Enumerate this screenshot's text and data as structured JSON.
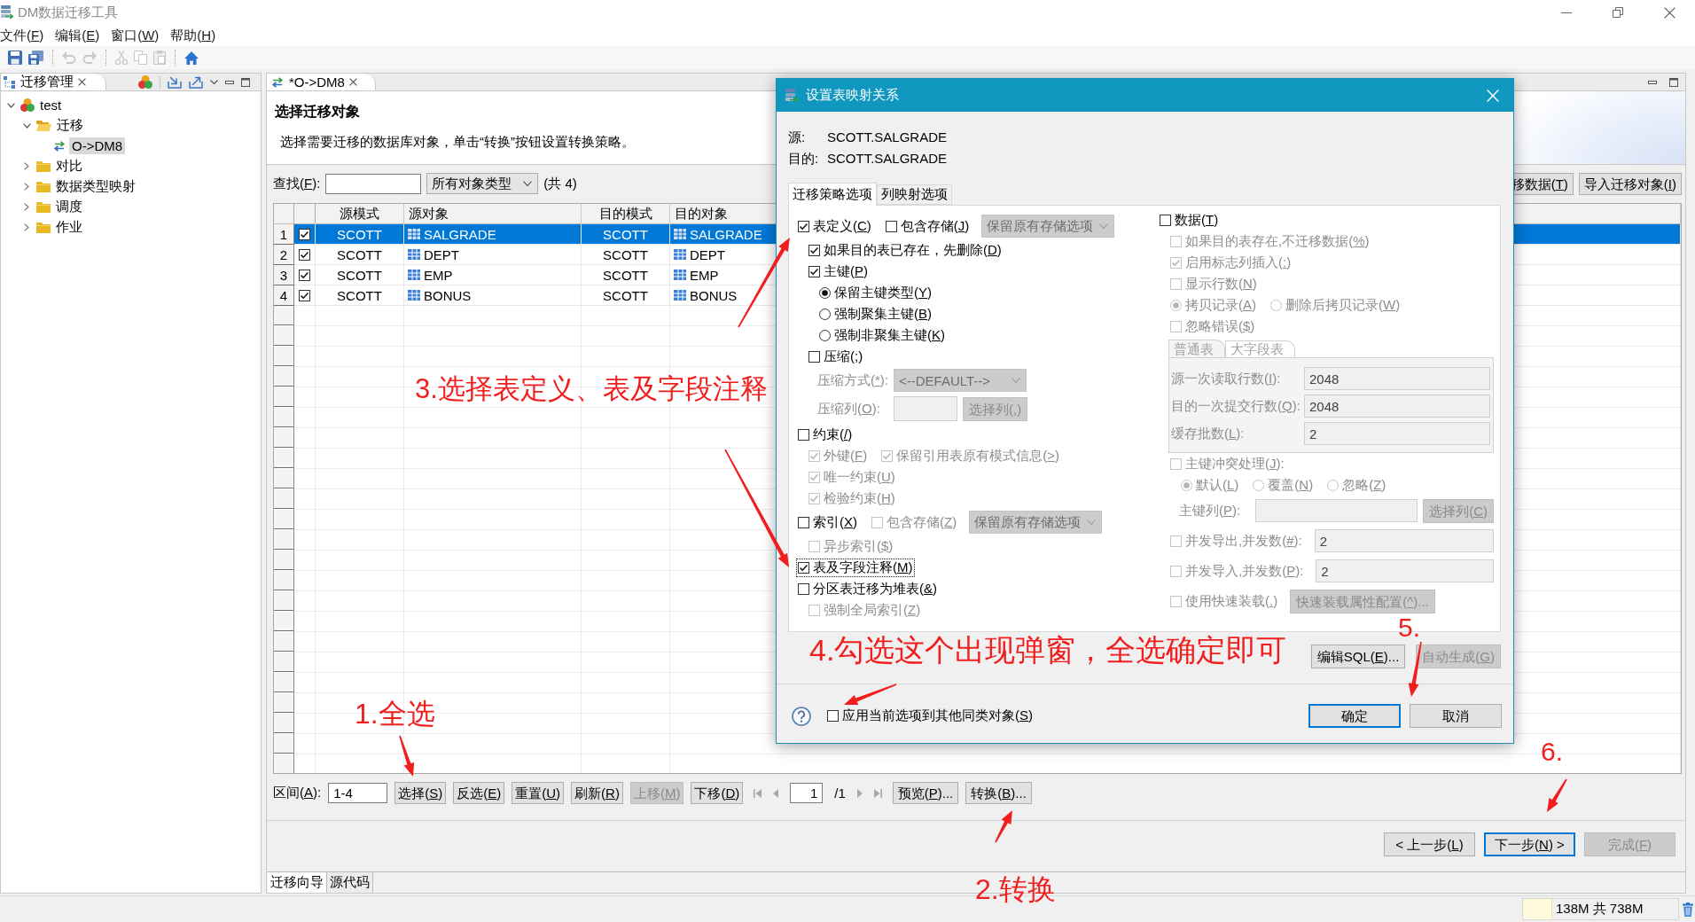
{
  "window": {
    "title": "DM数据迁移工具"
  },
  "menu": [
    "文件(F)",
    "编辑(E)",
    "窗口(W)",
    "帮助(H)"
  ],
  "toolbar": [
    {
      "kind": "save",
      "disabled": false
    },
    {
      "kind": "save_all",
      "disabled": false
    },
    {
      "kind": "undo",
      "disabled": true
    },
    {
      "kind": "redo",
      "disabled": true
    },
    {
      "kind": "cut",
      "disabled": true
    },
    {
      "kind": "copy",
      "disabled": true
    },
    {
      "kind": "paste",
      "disabled": true
    },
    {
      "kind": "home",
      "disabled": false
    }
  ],
  "navigator": {
    "tab": "迁移管理",
    "tree": [
      {
        "label": "test",
        "kind": "project",
        "expanded": true,
        "selected": false,
        "children": [
          {
            "label": "迁移",
            "kind": "folder",
            "expanded": true,
            "selected": false,
            "children": [
              {
                "label": "O->DM8",
                "kind": "migration",
                "selected": true
              }
            ]
          },
          {
            "label": "对比",
            "kind": "folder",
            "expanded": false,
            "selected": false
          },
          {
            "label": "数据类型映射",
            "kind": "folder",
            "expanded": false,
            "selected": false
          },
          {
            "label": "调度",
            "kind": "folder",
            "expanded": false,
            "selected": false
          },
          {
            "label": "作业",
            "kind": "folder",
            "expanded": false,
            "selected": false
          }
        ]
      }
    ]
  },
  "editor": {
    "tabs": [
      {
        "label": "*O->DM8",
        "selected": true
      }
    ],
    "title": "选择迁移对象",
    "description": "选择需要迁移的数据库对象，单击“转换”按钮设置转换策略。",
    "search_label": "查找(F):",
    "type_filter": "所有对象类型",
    "count": "(共 4)",
    "top_buttons": [
      "移数据(T)",
      "导入迁移对象(I)"
    ],
    "table": {
      "columns": [
        {
          "label": "源模式",
          "kind": "schema"
        },
        {
          "label": "源对象",
          "kind": "object"
        },
        {
          "label": "目的模式",
          "kind": "schema"
        },
        {
          "label": "目的对象",
          "kind": "object"
        }
      ],
      "rows": [
        {
          "number": "1",
          "checked": true,
          "selected": true,
          "cells": [
            "SCOTT",
            "SALGRADE",
            "SCOTT",
            "SALGRADE"
          ]
        },
        {
          "number": "2",
          "checked": true,
          "selected": false,
          "cells": [
            "SCOTT",
            "DEPT",
            "SCOTT",
            "DEPT"
          ]
        },
        {
          "number": "3",
          "checked": true,
          "selected": false,
          "cells": [
            "SCOTT",
            "EMP",
            "SCOTT",
            "EMP"
          ]
        },
        {
          "number": "4",
          "checked": true,
          "selected": false,
          "cells": [
            "SCOTT",
            "BONUS",
            "SCOTT",
            "BONUS"
          ]
        }
      ]
    },
    "range": {
      "label": "区间(A):",
      "value": "1-4"
    },
    "actions": [
      {
        "label": "选择(S)",
        "disabled": false
      },
      {
        "label": "反选(E)",
        "disabled": false
      },
      {
        "label": "重置(U)",
        "disabled": false
      },
      {
        "label": "刷新(R)",
        "disabled": false
      },
      {
        "label": "上移(M)",
        "disabled": true
      },
      {
        "label": "下移(D)",
        "disabled": false
      }
    ],
    "pager": {
      "page": "1",
      "total": "/1",
      "nav": [
        {
          "kind": "first",
          "disabled": true
        },
        {
          "kind": "previous",
          "disabled": true
        },
        {
          "kind": "next",
          "disabled": true
        },
        {
          "kind": "last",
          "disabled": true
        }
      ]
    },
    "more_actions": [
      {
        "label": "预览(P)...",
        "disabled": false
      },
      {
        "label": "转换(B)...",
        "disabled": false
      }
    ],
    "wizard_buttons": [
      {
        "label": "< 上一步(L)",
        "disabled": false,
        "default": false
      },
      {
        "label": "下一步(N) >",
        "disabled": false,
        "default": true
      },
      {
        "label": "完成(F)",
        "disabled": true,
        "default": false
      }
    ],
    "bottom_tabs": [
      {
        "label": "迁移向导",
        "selected": true
      },
      {
        "label": "源代码",
        "selected": false
      }
    ]
  },
  "status_bar": {
    "memory": {
      "reading": "138M 共 738M",
      "level": 0.19
    }
  },
  "dialog": {
    "title": "设置表映射关系",
    "source": {
      "label": "源:",
      "value": "SCOTT.SALGRADE"
    },
    "target": {
      "label": "目的:",
      "value": "SCOTT.SALGRADE"
    },
    "tabs": [
      {
        "label": "迁移策略选项",
        "selected": true
      },
      {
        "label": "列映射选项",
        "selected": false
      }
    ],
    "left_options": [
      {
        "kind": "options",
        "items": [
          {
            "kind": "checkbox",
            "label": "表定义(C)",
            "checked": true,
            "disabled": false,
            "focused": false
          },
          {
            "kind": "checkbox",
            "label": "包含存储(J)",
            "checked": false,
            "disabled": false,
            "focused": false
          },
          {
            "kind": "select",
            "value": "保留原有存储选项",
            "disabled": true
          }
        ],
        "children": [
          {
            "kind": "options",
            "items": [
              {
                "kind": "checkbox",
                "label": "如果目的表已存在，先删除(D)",
                "checked": true,
                "disabled": false,
                "focused": false
              }
            ]
          },
          {
            "kind": "options",
            "items": [
              {
                "kind": "checkbox",
                "label": "主键(P)",
                "checked": true,
                "disabled": false,
                "focused": false
              }
            ],
            "children": [
              {
                "kind": "options",
                "items": [
                  {
                    "kind": "radio",
                    "label": "保留主键类型(Y)",
                    "selected": true,
                    "disabled": false
                  }
                ]
              },
              {
                "kind": "options",
                "items": [
                  {
                    "kind": "radio",
                    "label": "强制聚集主键(B)",
                    "selected": false,
                    "disabled": false
                  }
                ]
              },
              {
                "kind": "options",
                "items": [
                  {
                    "kind": "radio",
                    "label": "强制非聚集主键(K)",
                    "selected": false,
                    "disabled": false
                  }
                ]
              }
            ]
          },
          {
            "kind": "options",
            "items": [
              {
                "kind": "checkbox",
                "label": "压缩(;)",
                "checked": false,
                "disabled": false,
                "focused": false
              }
            ],
            "children": [
              {
                "kind": "options",
                "items": [
                  {
                    "kind": "label",
                    "label": "压缩方式(*):",
                    "disabled": true
                  },
                  {
                    "kind": "select",
                    "value": "<--DEFAULT-->",
                    "disabled": true
                  }
                ]
              },
              {
                "kind": "options",
                "items": [
                  {
                    "kind": "label",
                    "label": "压缩列(O):",
                    "disabled": true
                  },
                  {
                    "kind": "input",
                    "disabled": true
                  },
                  {
                    "kind": "button",
                    "label": "选择列(,)",
                    "disabled": true
                  }
                ]
              }
            ]
          }
        ]
      },
      {
        "kind": "options",
        "items": [
          {
            "kind": "checkbox",
            "label": "约束(/)",
            "checked": false,
            "disabled": false,
            "focused": false
          }
        ],
        "children": [
          {
            "kind": "options",
            "items": [
              {
                "kind": "checkbox",
                "label": "外键(F)",
                "checked": true,
                "disabled": true,
                "focused": false
              },
              {
                "kind": "checkbox",
                "label": "保留引用表原有模式信息(>)",
                "checked": true,
                "disabled": true,
                "focused": false
              }
            ]
          },
          {
            "kind": "options",
            "items": [
              {
                "kind": "checkbox",
                "label": "唯一约束(U)",
                "checked": true,
                "disabled": true,
                "focused": false
              }
            ]
          },
          {
            "kind": "options",
            "items": [
              {
                "kind": "checkbox",
                "label": "检验约束(H)",
                "checked": true,
                "disabled": true,
                "focused": false
              }
            ]
          }
        ]
      },
      {
        "kind": "options",
        "items": [
          {
            "kind": "checkbox",
            "label": "索引(X)",
            "checked": false,
            "disabled": false,
            "focused": false
          },
          {
            "kind": "checkbox",
            "label": "包含存储(Z)",
            "checked": false,
            "disabled": true,
            "focused": false
          },
          {
            "kind": "select",
            "value": "保留原有存储选项",
            "disabled": true
          }
        ],
        "children": [
          {
            "kind": "options",
            "items": [
              {
                "kind": "checkbox",
                "label": "异步索引($)",
                "checked": false,
                "disabled": true,
                "focused": false
              }
            ]
          }
        ]
      },
      {
        "kind": "options",
        "items": [
          {
            "kind": "checkbox",
            "label": "表及字段注释(M)",
            "checked": true,
            "disabled": false,
            "focused": true
          }
        ]
      },
      {
        "kind": "options",
        "items": [
          {
            "kind": "checkbox",
            "label": "分区表迁移为堆表(&)",
            "checked": false,
            "disabled": false,
            "focused": false
          }
        ],
        "children": [
          {
            "kind": "options",
            "items": [
              {
                "kind": "checkbox",
                "label": "强制全局索引(Z)",
                "checked": false,
                "disabled": true,
                "focused": false
              }
            ]
          }
        ]
      }
    ],
    "right_options": [
      {
        "kind": "options",
        "items": [
          {
            "kind": "checkbox",
            "label": "数据(T)",
            "checked": false,
            "disabled": false,
            "focused": false
          }
        ],
        "children": [
          {
            "kind": "options",
            "items": [
              {
                "kind": "checkbox",
                "label": "如果目的表存在,不迁移数据(%)",
                "checked": false,
                "disabled": true,
                "focused": false
              }
            ]
          },
          {
            "kind": "options",
            "items": [
              {
                "kind": "checkbox",
                "label": "启用标志列插入(:)",
                "checked": true,
                "disabled": true,
                "focused": false
              }
            ]
          },
          {
            "kind": "options",
            "items": [
              {
                "kind": "checkbox",
                "label": "显示行数(N)",
                "checked": false,
                "disabled": true,
                "focused": false
              }
            ]
          },
          {
            "kind": "options",
            "items": [
              {
                "kind": "radio",
                "label": "拷贝记录(A)",
                "selected": true,
                "disabled": true
              },
              {
                "kind": "radio",
                "label": "删除后拷贝记录(W)",
                "selected": false,
                "disabled": true
              }
            ]
          },
          {
            "kind": "options",
            "items": [
              {
                "kind": "checkbox",
                "label": "忽略错误($)",
                "checked": false,
                "disabled": true,
                "focused": false
              }
            ]
          },
          {
            "kind": "tab_panel",
            "disabled": true,
            "tabs": [
              {
                "label": "普通表",
                "selected": true
              },
              {
                "label": "大字段表",
                "selected": false
              }
            ],
            "fields": [
              {
                "label": "源一次读取行数(I):",
                "value": "2048"
              },
              {
                "label": "目的一次提交行数(Q):",
                "value": "2048"
              },
              {
                "label": "缓存批数(L):",
                "value": "2"
              }
            ]
          },
          {
            "kind": "options",
            "items": [
              {
                "kind": "checkbox",
                "label": "主键冲突处理(J):",
                "checked": false,
                "disabled": true,
                "focused": false
              }
            ],
            "children": [
              {
                "kind": "options",
                "items": [
                  {
                    "kind": "radio",
                    "label": "默认(L)",
                    "selected": true,
                    "disabled": true
                  },
                  {
                    "kind": "radio",
                    "label": "覆盖(N)",
                    "selected": false,
                    "disabled": true
                  },
                  {
                    "kind": "radio",
                    "label": "忽略(Z)",
                    "selected": false,
                    "disabled": true
                  }
                ]
              },
              {
                "kind": "options",
                "items": [
                  {
                    "kind": "label",
                    "label": "主键列(P):",
                    "disabled": true
                  },
                  {
                    "kind": "input",
                    "disabled": true
                  },
                  {
                    "kind": "button",
                    "label": "选择列(C)",
                    "disabled": true
                  }
                ]
              }
            ]
          },
          {
            "kind": "options",
            "items": [
              {
                "kind": "checkbox",
                "label": "并发导出,并发数(#):",
                "checked": false,
                "disabled": true,
                "focused": false
              },
              {
                "kind": "input",
                "value": "2",
                "disabled": true
              }
            ]
          },
          {
            "kind": "options",
            "items": [
              {
                "kind": "checkbox",
                "label": "并发导入,并发数(P):",
                "checked": false,
                "disabled": true,
                "focused": false
              },
              {
                "kind": "input",
                "value": "2",
                "disabled": true
              }
            ]
          },
          {
            "kind": "options",
            "items": [
              {
                "kind": "checkbox",
                "label": "使用快速装载(.)",
                "checked": false,
                "disabled": true,
                "focused": false
              },
              {
                "kind": "button",
                "label": "快速装载属性配置(^)...",
                "disabled": true
              }
            ]
          }
        ]
      }
    ],
    "panel_buttons": [
      {
        "label": "编辑SQL(E)...",
        "disabled": false
      },
      {
        "label": "自动生成(G)",
        "disabled": true
      }
    ],
    "apply_all": {
      "label": "应用当前选项到其他同类对象(S)",
      "checked": false
    },
    "buttons": [
      {
        "label": "确定",
        "default": true
      },
      {
        "label": "取消",
        "default": false
      }
    ]
  },
  "annotations": [
    "3.选择表定义、表及字段注释",
    "5.",
    "4.勾选这个出现弹窗，全选确定即可",
    "1.全选",
    "6.",
    "2.转换"
  ]
}
